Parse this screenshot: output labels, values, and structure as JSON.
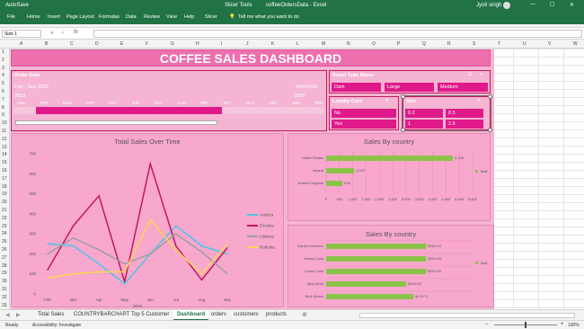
{
  "titlebar": {
    "autosave": "AutoSave",
    "title": "coffeeOrdersData - Excel",
    "contextual_tab": "Slicer Tools",
    "user": "Jyoti singh"
  },
  "ribbon": {
    "tabs": [
      "File",
      "Home",
      "Insert",
      "Page Layout",
      "Formulas",
      "Data",
      "Review",
      "View",
      "Help",
      "Slicer"
    ],
    "search": "Tell me what you want to do"
  },
  "formula_bar": {
    "name_box": "Size 1",
    "fx": "fx",
    "value": ""
  },
  "columns": [
    "A",
    "B",
    "C",
    "D",
    "E",
    "F",
    "G",
    "H",
    "I",
    "J",
    "K",
    "L",
    "M",
    "N",
    "O",
    "P",
    "Q",
    "R",
    "S",
    "T",
    "U",
    "V",
    "W"
  ],
  "rows": [
    "1",
    "2",
    "3",
    "4",
    "5",
    "6",
    "7",
    "8",
    "9",
    "10",
    "11",
    "12",
    "13",
    "14",
    "15",
    "16",
    "17",
    "18",
    "19",
    "20",
    "21",
    "22",
    "23",
    "24",
    "25",
    "26",
    "27",
    "28",
    "29",
    "30",
    "31",
    "32",
    "33"
  ],
  "dashboard": {
    "title": "COFFEE SALES DASHBOARD",
    "order_date": {
      "header": "Order Date",
      "range_label": "Feb - Sep 2019",
      "unit": "MONTHS",
      "year1": "2019",
      "year2": "2020",
      "months": [
        "JAN",
        "FEB",
        "MAR",
        "APR",
        "MAY",
        "JUN",
        "JUL",
        "AUG",
        "SEP",
        "OCT",
        "NOV",
        "DEC",
        "JAN",
        "FEB"
      ]
    },
    "roast_type": {
      "header": "Roast Type Name",
      "options": [
        "Dark",
        "Large",
        "Medium"
      ]
    },
    "loyalty_card": {
      "header": "Loyalty Card",
      "options": [
        "No",
        "Yes"
      ]
    },
    "size": {
      "header": "Size",
      "options": [
        "0.2",
        "0.5",
        "1",
        "2.5"
      ]
    }
  },
  "line_chart": {
    "title": "Total Sales Over Time",
    "xlabel": "2019",
    "legend": [
      "Arabica",
      "Excelsa",
      "Liberica",
      "Robusta"
    ]
  },
  "bar_chart_1": {
    "title": "Sales By country",
    "legend": "Total"
  },
  "bar_chart_2": {
    "title": "Sales By country",
    "legend": "Total"
  },
  "chart_data": [
    {
      "type": "line",
      "title": "Total Sales Over Time",
      "xlabel": "2019",
      "ylabel": "",
      "categories": [
        "Feb",
        "Mar",
        "Apr",
        "May",
        "Jun",
        "Jul",
        "Aug",
        "Sep"
      ],
      "ylim": [
        0,
        700
      ],
      "yticks": [
        0,
        100,
        200,
        300,
        400,
        500,
        600,
        700
      ],
      "series": [
        {
          "name": "Arabica",
          "color": "#4fc3e8",
          "values": [
            250,
            240,
            150,
            50,
            200,
            340,
            240,
            200
          ]
        },
        {
          "name": "Excelsa",
          "color": "#c2185b",
          "values": [
            120,
            340,
            490,
            60,
            650,
            240,
            70,
            230
          ]
        },
        {
          "name": "Liberica",
          "color": "#9e9e9e",
          "values": [
            200,
            280,
            220,
            150,
            200,
            300,
            210,
            100
          ]
        },
        {
          "name": "Robusta",
          "color": "#ffd54f",
          "values": [
            80,
            100,
            110,
            110,
            370,
            220,
            100,
            250
          ]
        }
      ]
    },
    {
      "type": "bar",
      "title": "Sales By country",
      "categories": [
        "United States",
        "Ireland",
        "United Kingdom"
      ],
      "values": [
        4755,
        1047,
        616
      ],
      "data_labels": [
        "4,755",
        "1,047",
        "616"
      ],
      "xlim": [
        0,
        5500
      ],
      "xticks": [
        "0",
        "500",
        "1,000",
        "1,500",
        "2,000",
        "2,500",
        "3,000",
        "3,500",
        "4,000",
        "4,500",
        "5,000",
        "5,500"
      ],
      "legend": "Total",
      "color": "#8bc34a"
    },
    {
      "type": "bar",
      "title": "Sales By country",
      "categories": [
        "Daniel Hommen",
        "Nanny Lush",
        "Laurie Tuinl",
        "Alley Brett",
        "Bridi Simon"
      ],
      "values": [
        204.93,
        204.93,
        204.93,
        164.03,
        178.71
      ],
      "data_labels": [
        "$204.93",
        "$204.93",
        "$204.93",
        "$164.03",
        "$178.71"
      ],
      "xlim": [
        0,
        300
      ],
      "legend": "Total",
      "color": "#8bc34a"
    }
  ],
  "sheet_tabs": [
    "Total Sales",
    "COUNTRYBARCHART",
    "Top 5 Customer",
    "Dashboard",
    "orders",
    "customers",
    "products"
  ],
  "active_tab": "Dashboard",
  "status": {
    "ready": "Ready",
    "accessibility": "Accessibility: Investigate",
    "zoom": "100%"
  }
}
